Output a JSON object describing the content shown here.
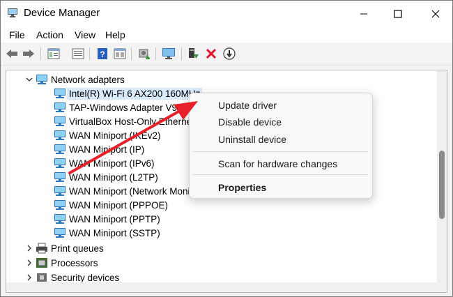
{
  "window": {
    "title": "Device Manager",
    "minimize_icon": "minimize-icon",
    "maximize_icon": "maximize-icon",
    "close_icon": "close-icon"
  },
  "menu": [
    "File",
    "Action",
    "View",
    "Help"
  ],
  "toolbar": {
    "icons": [
      "back-icon",
      "forward-icon",
      "properties-icon",
      "view-icon",
      "help-icon",
      "show-hidden-icon",
      "scan-icon",
      "monitor-icon",
      "update-driver-icon",
      "uninstall-icon",
      "disable-icon"
    ]
  },
  "tree": {
    "network_adapters": "Network adapters",
    "adapters": [
      "Intel(R) Wi-Fi 6 AX200 160MHz",
      "TAP-Windows Adapter V9",
      "VirtualBox Host-Only Ethernet",
      "WAN Miniport (IKEv2)",
      "WAN Miniport (IP)",
      "WAN Miniport (IPv6)",
      "WAN Miniport (L2TP)",
      "WAN Miniport (Network Monitor)",
      "WAN Miniport (PPPOE)",
      "WAN Miniport (PPTP)",
      "WAN Miniport (SSTP)"
    ],
    "print_queues": "Print queues",
    "processors": "Processors",
    "security_devices": "Security devices"
  },
  "context_menu": {
    "update_driver": "Update driver",
    "disable_device": "Disable device",
    "uninstall_device": "Uninstall device",
    "scan": "Scan for hardware changes",
    "properties": "Properties"
  },
  "colors": {
    "arrow": "#e8202a",
    "selection": "#d9ebfb",
    "accent": "#0078d4"
  }
}
